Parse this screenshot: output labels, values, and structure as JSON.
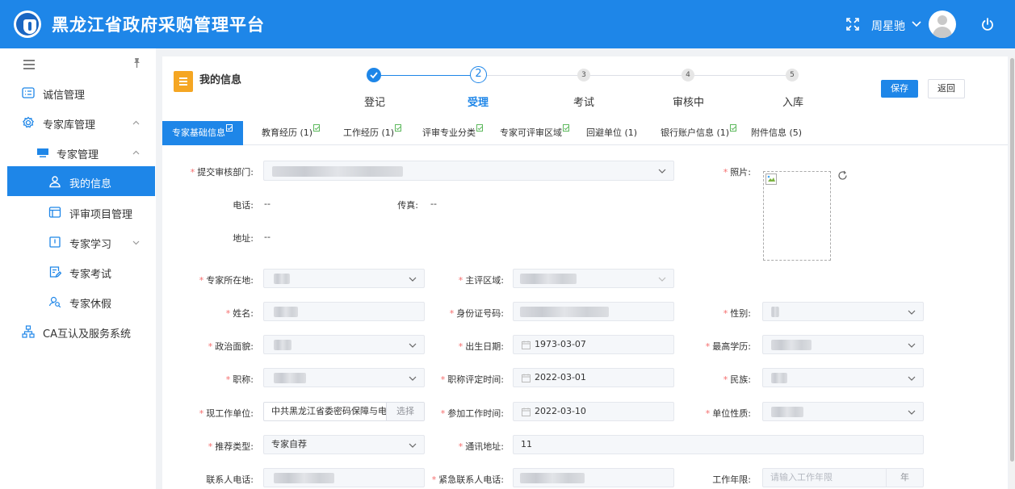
{
  "header": {
    "title": "黑龙江省政府采购管理平台",
    "user_name": "周星驰"
  },
  "sidebar": {
    "items": [
      {
        "label": "诚信管理"
      },
      {
        "label": "专家库管理"
      },
      {
        "label": "专家管理"
      },
      {
        "label": "我的信息"
      },
      {
        "label": "评审项目管理"
      },
      {
        "label": "专家学习"
      },
      {
        "label": "专家考试"
      },
      {
        "label": "专家休假"
      },
      {
        "label": "CA互认及服务系统"
      }
    ]
  },
  "page": {
    "title": "我的信息",
    "save_label": "保存",
    "back_label": "返回"
  },
  "steps": [
    {
      "num": "",
      "label": "登记"
    },
    {
      "num": "2",
      "label": "受理"
    },
    {
      "num": "3",
      "label": "考试"
    },
    {
      "num": "4",
      "label": "审核中"
    },
    {
      "num": "5",
      "label": "入库"
    }
  ],
  "tabs": [
    {
      "label": "专家基础信息"
    },
    {
      "label": "教育经历 (1)"
    },
    {
      "label": "工作经历 (1)"
    },
    {
      "label": "评审专业分类"
    },
    {
      "label": "专家可评审区域"
    },
    {
      "label": "回避单位 (1)"
    },
    {
      "label": "银行账户信息 (1)"
    },
    {
      "label": "附件信息 (5)"
    }
  ],
  "form": {
    "dept": {
      "label": "提交审核部门:"
    },
    "phone": {
      "label": "电话:",
      "value": "--"
    },
    "fax": {
      "label": "传真:",
      "value": "--"
    },
    "address": {
      "label": "地址:",
      "value": "--"
    },
    "photo": {
      "label": "照片:"
    },
    "location": {
      "label": "专家所在地:"
    },
    "main_area": {
      "label": "主评区域:"
    },
    "name": {
      "label": "姓名:"
    },
    "id_no": {
      "label": "身份证号码:"
    },
    "gender": {
      "label": "性别:"
    },
    "political": {
      "label": "政治面貌:"
    },
    "birth": {
      "label": "出生日期:",
      "value": "1973-03-07"
    },
    "education": {
      "label": "最高学历:"
    },
    "title": {
      "label": "职称:"
    },
    "title_date": {
      "label": "职称评定时间:",
      "value": "2022-03-01"
    },
    "ethnicity": {
      "label": "民族:"
    },
    "employer": {
      "label": "现工作单位:",
      "value": "中共黑龙江省委密码保障与电子",
      "choose": "选择"
    },
    "work_start": {
      "label": "参加工作时间:",
      "value": "2022-03-10"
    },
    "unit_type": {
      "label": "单位性质:"
    },
    "recommend": {
      "label": "推荐类型:",
      "value": "专家自荐"
    },
    "mail_addr": {
      "label": "通讯地址:",
      "value": "11"
    },
    "contact_phone": {
      "label": "联系人电话:"
    },
    "emergency_phone": {
      "label": "紧急联系人电话:"
    },
    "years": {
      "label": "工作年限:",
      "placeholder": "请输入工作年限",
      "unit": "年"
    }
  }
}
